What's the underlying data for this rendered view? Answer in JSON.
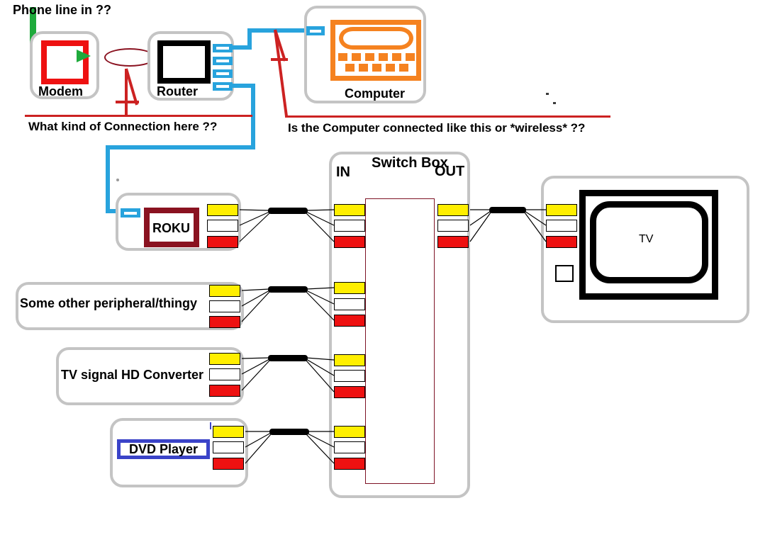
{
  "diagram": {
    "title_annotations": {
      "phone_line": "Phone line in ??",
      "connection_question": "What kind of Connection here ??",
      "computer_question": "Is the Computer connected like this or *wireless* ??"
    },
    "colors": {
      "ethernet_blue": "#28a3dd",
      "phone_green": "#1faa3c",
      "annotation_red": "#cc2222",
      "modem_screen": "#ee1111",
      "router_screen": "#000000",
      "computer_orange": "#f58220",
      "roku_maroon": "#8a1220",
      "dvd_blue": "#3a43c8",
      "jack_yellow": "#ffef00",
      "jack_white": "#ffffff",
      "jack_red": "#ee1111",
      "device_border": "#c4c4c4",
      "cable_bundle": "#000000"
    },
    "devices": {
      "modem": {
        "label": "Modem"
      },
      "router": {
        "label": "Router"
      },
      "computer": {
        "label": "Computer"
      },
      "roku": {
        "label": "ROKU"
      },
      "peripheral": {
        "label": "Some other peripheral/thingy"
      },
      "converter": {
        "label": "TV signal HD Converter"
      },
      "dvd": {
        "label": "DVD Player"
      },
      "tv": {
        "label": "TV"
      },
      "switchbox": {
        "label": "Switch Box",
        "in_label": "IN",
        "out_label": "OUT",
        "in_port_groups": 4,
        "out_port_groups": 1
      }
    },
    "av_jack_colors": [
      "yellow",
      "white",
      "red"
    ],
    "source_devices": [
      "ROKU",
      "Some other peripheral/thingy",
      "TV signal HD Converter",
      "DVD Player"
    ]
  }
}
